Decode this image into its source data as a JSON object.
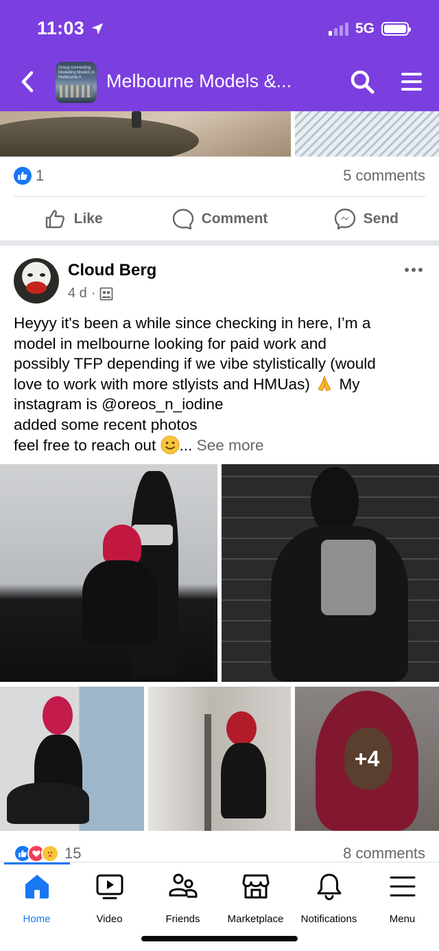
{
  "status_bar": {
    "time": "11:03",
    "network": "5G",
    "location_icon": "location-arrow-icon",
    "signal_bars_filled": 1,
    "signal_bars_total": 4,
    "battery_level": 1.0
  },
  "header": {
    "background_color": "#7b3fe0",
    "group_title": "Melbourne Models &...",
    "group_thumb_text": "Group connecting Modelling Models in Melbourne A"
  },
  "previous_post": {
    "reaction_count": "1",
    "comments_label": "5 comments",
    "actions": {
      "like": "Like",
      "comment": "Comment",
      "send": "Send"
    }
  },
  "post": {
    "author": "Cloud Berg",
    "age": "4 d",
    "meta_separator": "·",
    "audience_icon": "group-members-icon",
    "text_lines": [
      "Heyyy it's been a while since checking in here, I’m a",
      "model in melbourne looking for paid work and",
      "possibly TFP depending if we vibe stylistically (would",
      "love to work with more stlyists and HMUas)",
      "My",
      "instagram is @oreos_n_iodine",
      " added some recent photos",
      "feel free to reach out",
      "...",
      "See more"
    ],
    "extra_photos_label": "+4",
    "reaction_count": "15",
    "comments_label": "8 comments"
  },
  "tabbar": {
    "accent_color": "#1877f2",
    "tabs": [
      {
        "label": "Home",
        "icon": "home-icon",
        "active": true
      },
      {
        "label": "Video",
        "icon": "video-icon",
        "active": false
      },
      {
        "label": "Friends",
        "icon": "friends-icon",
        "active": false
      },
      {
        "label": "Marketplace",
        "icon": "marketplace-icon",
        "active": false
      },
      {
        "label": "Notifications",
        "icon": "bell-icon",
        "active": false
      },
      {
        "label": "Menu",
        "icon": "hamburger-icon",
        "active": false
      }
    ]
  }
}
